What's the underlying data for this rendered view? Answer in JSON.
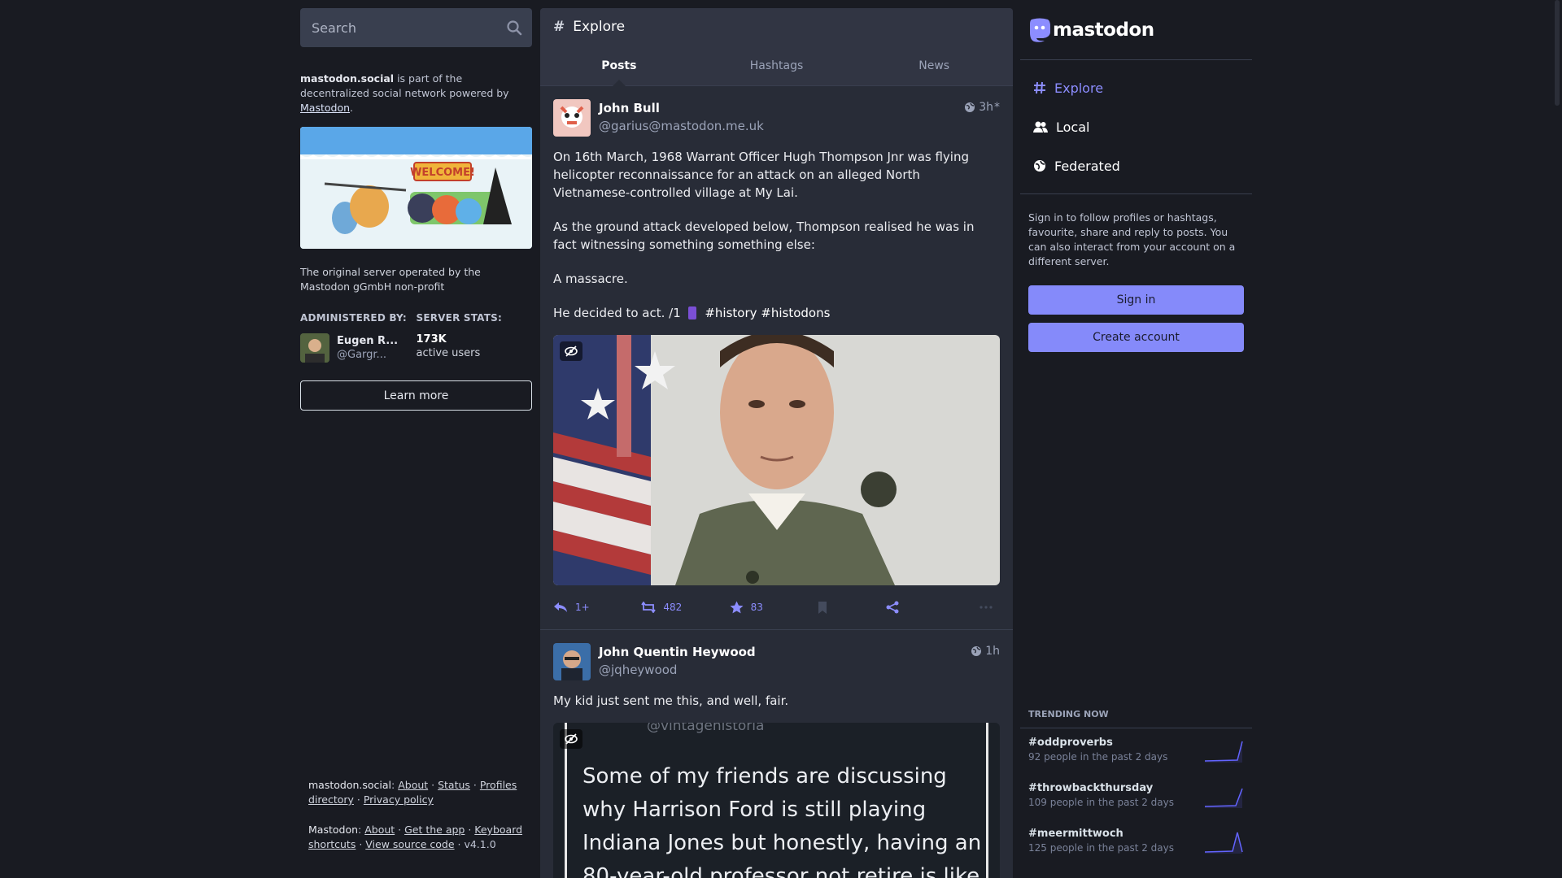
{
  "search": {
    "placeholder": "Search"
  },
  "server": {
    "domain": "mastodon.social",
    "intro_text": " is part of the decentralized social network powered by ",
    "powered_by": "Mastodon",
    "description": "The original server operated by the Mastodon gGmbH non-profit",
    "hero_banner_text": "WELCOME!",
    "administered_label": "ADMINISTERED BY:",
    "admin_name": "Eugen R...",
    "admin_handle": "@Gargr...",
    "stats_label": "SERVER STATS:",
    "stat_value": "173K",
    "stat_label": "active users",
    "learn_more": "Learn more"
  },
  "footer": {
    "site": "mastodon.social",
    "site_links": [
      "About",
      "Status",
      "Profiles directory",
      "Privacy policy"
    ],
    "app": "Mastodon",
    "app_links": [
      "About",
      "Get the app",
      "Keyboard shortcuts",
      "View source code"
    ],
    "version": "v4.1.0"
  },
  "explore": {
    "title": "Explore",
    "tabs": [
      {
        "label": "Posts"
      },
      {
        "label": "Hashtags"
      },
      {
        "label": "News"
      }
    ]
  },
  "posts": [
    {
      "display_name": "John Bull",
      "acct": "@garius@mastodon.me.uk",
      "time": "3h",
      "paragraphs": [
        "On 16th March, 1968 Warrant Officer Hugh Thompson Jnr was flying helicopter reconnaissance for an attack on an alleged North Vietnamese-controlled village at My Lai.",
        "As the ground attack developed below, Thompson realised he was in fact witnessing something something else:",
        "A massacre."
      ],
      "last_line": "He decided to act. /1",
      "hashtags": "#history #histodons",
      "replies": "1+",
      "boosts": "482",
      "favourites": "83"
    },
    {
      "display_name": "John Quentin Heywood",
      "acct": "@jqheywood",
      "time": "1h",
      "text": "My kid just sent me this, and well, fair.",
      "image_lines": [
        "@vintagehistoria",
        "Some of my friends are discussing",
        "why Harrison Ford is still playing",
        "Indiana Jones but honestly, having an",
        "80-year-old professor not retire is like"
      ]
    }
  ],
  "sidebar": {
    "logo": "mastodon",
    "nav": [
      {
        "label": "Explore"
      },
      {
        "label": "Local"
      },
      {
        "label": "Federated"
      }
    ],
    "signin_blurb": "Sign in to follow profiles or hashtags, favourite, share and reply to posts. You can also interact from your account on a different server.",
    "sign_in": "Sign in",
    "create_account": "Create account",
    "trending_title": "TRENDING NOW",
    "trends": [
      {
        "name": "#oddproverbs",
        "count": "92 people in the past 2 days"
      },
      {
        "name": "#throwbackthursday",
        "count": "109 people in the past 2 days"
      },
      {
        "name": "#meermittwoch",
        "count": "125 people in the past 2 days"
      }
    ]
  },
  "colors": {
    "accent": "#8c8dff",
    "button": "#858afa",
    "background": "#191b22",
    "column": "#282c37"
  }
}
